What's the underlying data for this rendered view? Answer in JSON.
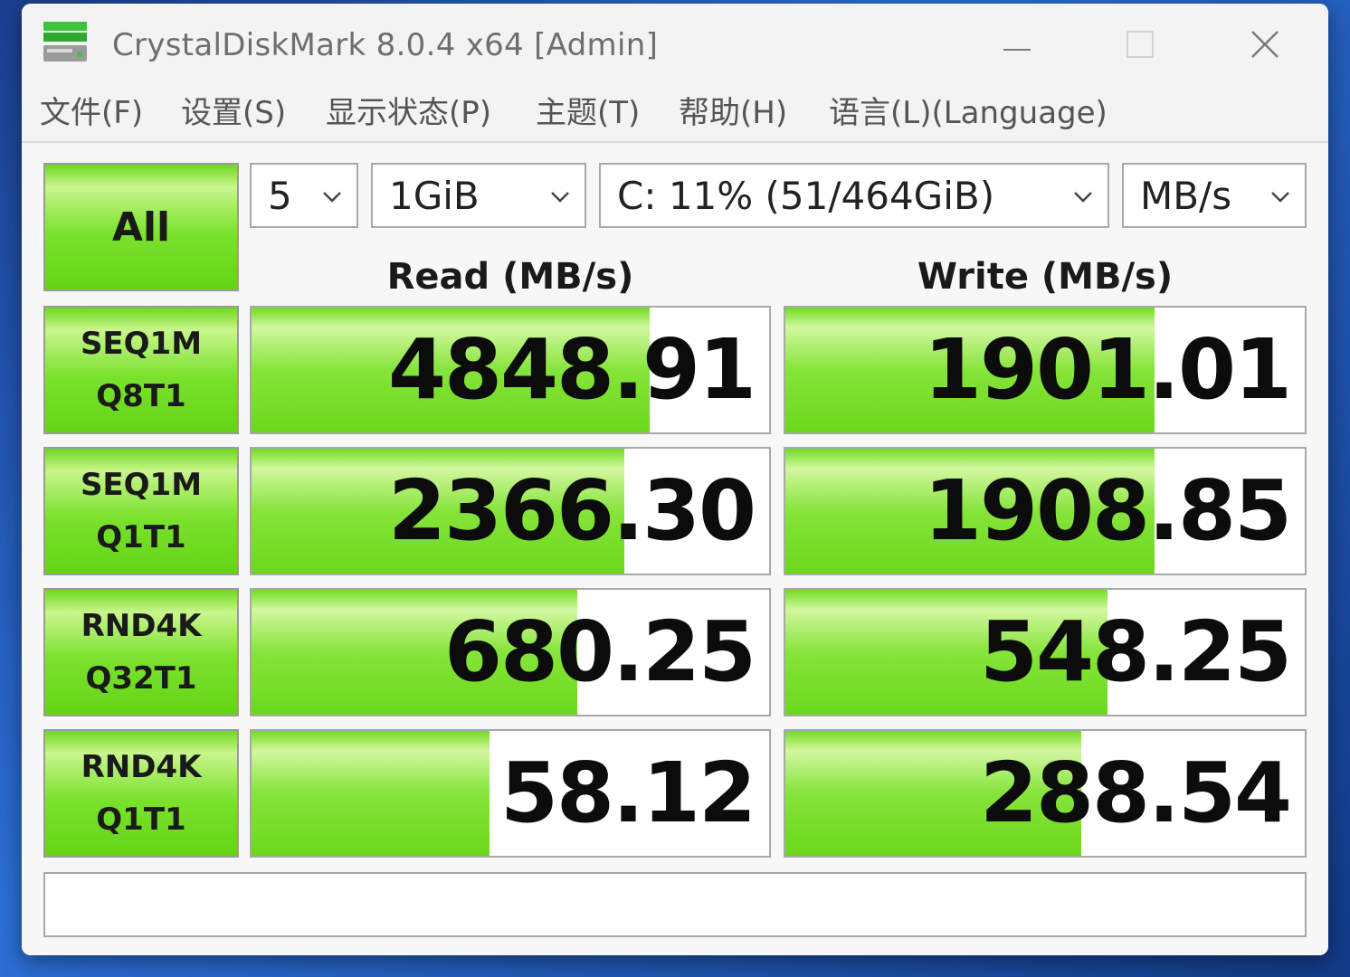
{
  "window": {
    "title": "CrystalDiskMark 8.0.4 x64 [Admin]"
  },
  "menu": {
    "items": [
      "文件(F)",
      "设置(S)",
      "显示状态(P)",
      "主题(T)",
      "帮助(H)",
      "语言(L)(Language)"
    ]
  },
  "controls": {
    "all_label": "All",
    "count": "5",
    "size": "1GiB",
    "drive": "C: 11% (51/464GiB)",
    "unit": "MB/s"
  },
  "headers": {
    "read": "Read (MB/s)",
    "write": "Write (MB/s)"
  },
  "results": [
    {
      "line1": "SEQ1M",
      "line2": "Q8T1",
      "read": "4848.91",
      "write": "1901.01",
      "read_fill": 0.77,
      "write_fill": 0.71
    },
    {
      "line1": "SEQ1M",
      "line2": "Q1T1",
      "read": "2366.30",
      "write": "1908.85",
      "read_fill": 0.72,
      "write_fill": 0.71
    },
    {
      "line1": "RND4K",
      "line2": "Q32T1",
      "read": "680.25",
      "write": "548.25",
      "read_fill": 0.63,
      "write_fill": 0.62
    },
    {
      "line1": "RND4K",
      "line2": "Q1T1",
      "read": "58.12",
      "write": "288.54",
      "read_fill": 0.46,
      "write_fill": 0.57
    }
  ],
  "comment": "",
  "colors": {
    "bar_green": "#7be22e",
    "window_bg": "#ffffff",
    "desktop_blue": "#2c6fd6"
  }
}
